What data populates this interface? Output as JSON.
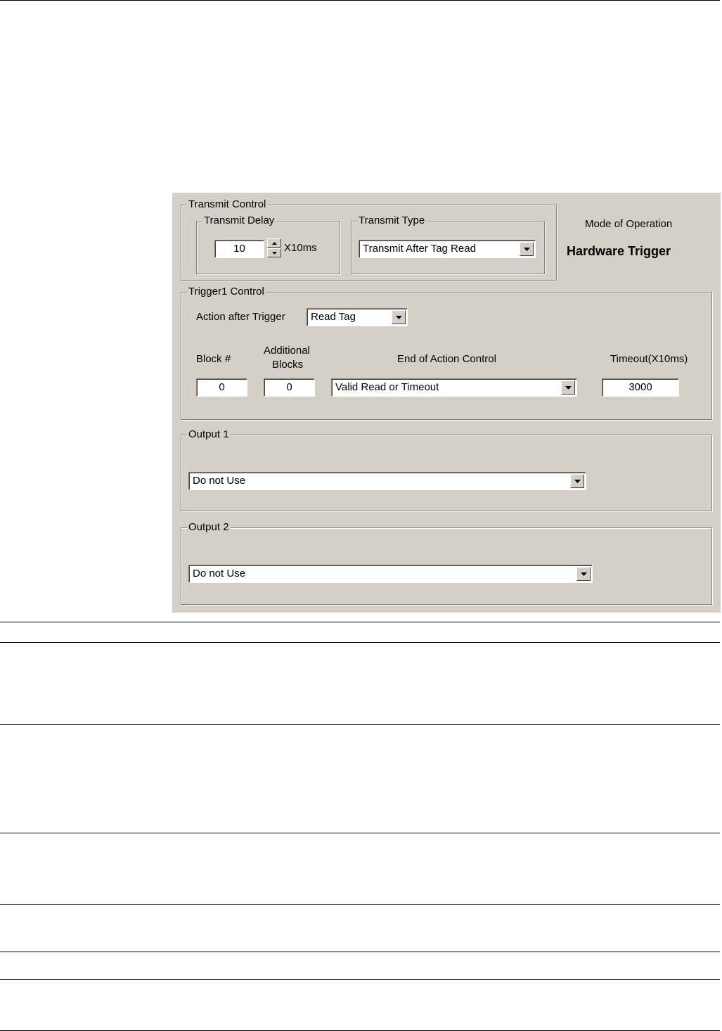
{
  "transmit_control": {
    "legend": "Transmit Control",
    "transmit_delay": {
      "legend": "Transmit Delay",
      "value": "10",
      "unit": "X10ms"
    },
    "transmit_type": {
      "legend": "Transmit Type",
      "selected": "Transmit After Tag Read"
    }
  },
  "mode": {
    "label": "Mode of Operation",
    "value": "Hardware Trigger"
  },
  "trigger1_control": {
    "legend": "Trigger1 Control",
    "action_label": "Action after Trigger",
    "action_selected": "Read Tag",
    "block_label": "Block #",
    "additional_label_line1": "Additional",
    "additional_label_line2": "Blocks",
    "end_action_label": "End of Action Control",
    "timeout_label": "Timeout(X10ms)",
    "block_value": "0",
    "additional_value": "0",
    "end_action_selected": "Valid Read or Timeout",
    "timeout_value": "3000"
  },
  "output1": {
    "legend": "Output 1",
    "selected": "Do not Use"
  },
  "output2": {
    "legend": "Output 2",
    "selected": "Do not Use"
  },
  "icons": [
    "up-arrow-icon",
    "down-arrow-icon",
    "dropdown-arrow-icon"
  ]
}
